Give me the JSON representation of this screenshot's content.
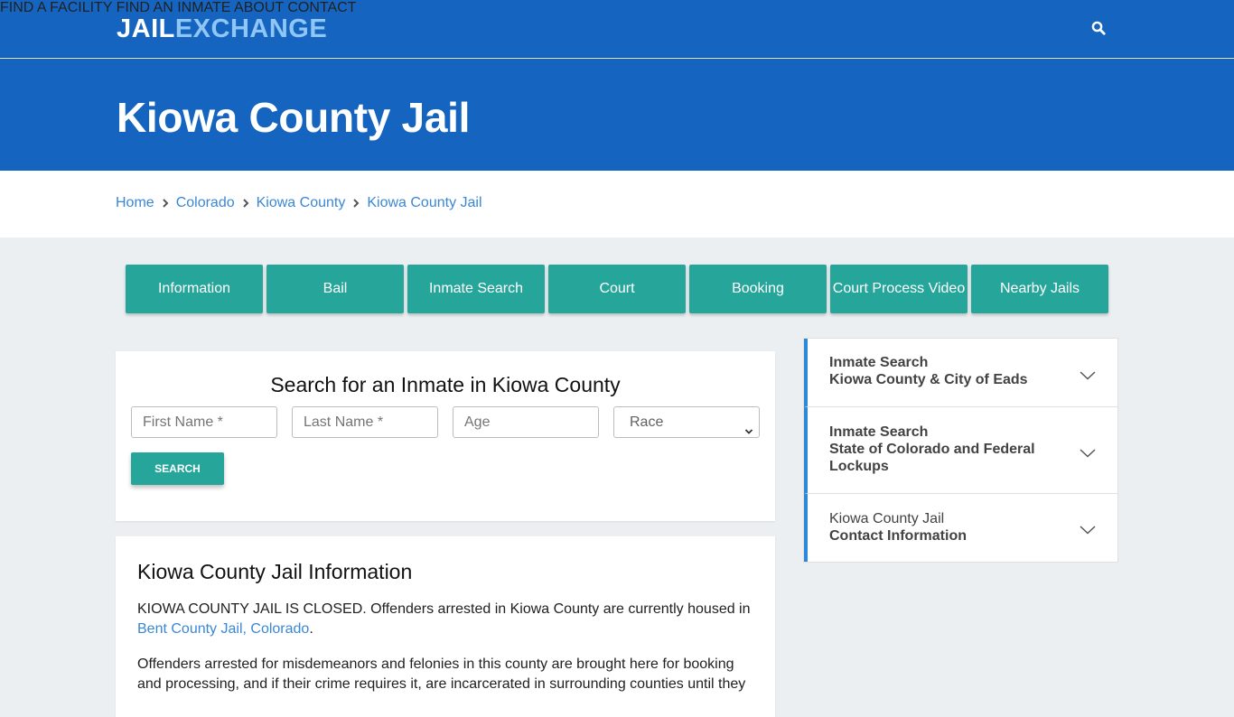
{
  "brand": {
    "logo_part1": "JAIL",
    "logo_part2": "EXCHANGE"
  },
  "nav": {
    "items": [
      {
        "label": "FIND A FACILITY"
      },
      {
        "label": "FIND AN INMATE"
      },
      {
        "label": "ABOUT"
      },
      {
        "label": "CONTACT"
      }
    ],
    "search_icon": "search-icon"
  },
  "hero": {
    "title": "Kiowa County Jail"
  },
  "breadcrumb": [
    {
      "label": "Home"
    },
    {
      "label": "Colorado"
    },
    {
      "label": "Kiowa County"
    },
    {
      "label": "Kiowa County Jail"
    }
  ],
  "tabs": [
    {
      "label": "Information"
    },
    {
      "label": "Bail"
    },
    {
      "label": "Inmate Search"
    },
    {
      "label": "Court"
    },
    {
      "label": "Booking"
    },
    {
      "label": "Court Process Video"
    },
    {
      "label": "Nearby Jails"
    }
  ],
  "search_form": {
    "title": "Search for an Inmate in Kiowa County",
    "first_name_placeholder": "First Name *",
    "last_name_placeholder": "Last Name *",
    "age_placeholder": "Age",
    "race_selected": "Race",
    "submit_label": "SEARCH"
  },
  "info": {
    "title": "Kiowa County Jail Information",
    "p1_text": "KIOWA COUNTY JAIL IS CLOSED. Offenders arrested in Kiowa County are currently housed in ",
    "p1_link": "Bent County Jail, Colorado",
    "p1_end": ".",
    "p2_text": "Offenders arrested for misdemeanors and felonies in this county are brought here for booking and processing, and if their crime requires it, are incarcerated in surrounding counties until they"
  },
  "sidebar": {
    "items": [
      {
        "line1": "Inmate Search",
        "line2": "Kiowa County & City of Eads"
      },
      {
        "line1": "Inmate Search",
        "line2": "State of Colorado and Federal Lockups"
      },
      {
        "line1": "Kiowa County Jail",
        "line2": "Contact Information"
      }
    ]
  },
  "colors": {
    "primary_blue": "#1565c0",
    "logo_accent": "#90c6f5",
    "teal": "#26a69a",
    "link_blue": "#3a87d6",
    "accordion_accent": "#2e88d8"
  }
}
